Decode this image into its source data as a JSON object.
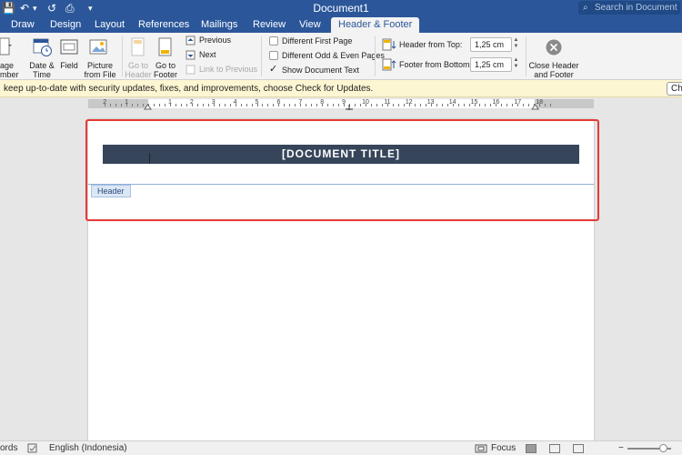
{
  "titlebar": {
    "title": "Document1",
    "search_placeholder": "Search in Document",
    "qa_save": "💾",
    "qa_undo": "↶",
    "qa_undo_menu": "▾",
    "qa_redo": "↺",
    "qa_print": "⎙",
    "qa_customize": "▾"
  },
  "tabs": [
    {
      "label": "Draw"
    },
    {
      "label": "Design"
    },
    {
      "label": "Layout"
    },
    {
      "label": "References"
    },
    {
      "label": "Mailings"
    },
    {
      "label": "Review"
    },
    {
      "label": "View"
    },
    {
      "label": "Header & Footer",
      "active": true
    }
  ],
  "ribbon": {
    "page_number": {
      "line1": "age",
      "line2": "mber"
    },
    "date_time": {
      "line1": "Date &",
      "line2": "Time"
    },
    "field": {
      "line1": "Field"
    },
    "picture": {
      "line1": "Picture",
      "line2": "from File"
    },
    "go_to_header": {
      "line1": "Go to",
      "line2": "Header"
    },
    "go_to_footer": {
      "line1": "Go to",
      "line2": "Footer"
    },
    "previous": "Previous",
    "next": "Next",
    "link_to_previous": "Link to Previous",
    "different_first_page": "Different First Page",
    "different_odd_even": "Different Odd & Even Pages",
    "show_document_text": "Show Document Text",
    "header_from_top_label": "Header from Top:",
    "header_from_top_value": "1,25 cm",
    "footer_from_bottom_label": "Footer from Bottom:",
    "footer_from_bottom_value": "1,25 cm",
    "close": {
      "line1": "Close Header",
      "line2": "and Footer"
    }
  },
  "message_bar": {
    "text": "keep up-to-date with security updates, fixes, and improvements, choose Check for Updates.",
    "button": "Check"
  },
  "ruler": {
    "numbers": [
      "2",
      "1",
      "1",
      "2",
      "3",
      "4",
      "5",
      "6",
      "7",
      "8",
      "9",
      "10",
      "11",
      "12",
      "13",
      "14",
      "15",
      "16",
      "17",
      "18"
    ]
  },
  "document": {
    "header_title": "[DOCUMENT TITLE]",
    "header_tag": "Header"
  },
  "statusbar": {
    "words": "ords",
    "language": "English (Indonesia)",
    "focus": "Focus"
  },
  "colors": {
    "accent": "#2b579a",
    "title_band": "#36455a",
    "highlight": "#e53935"
  }
}
